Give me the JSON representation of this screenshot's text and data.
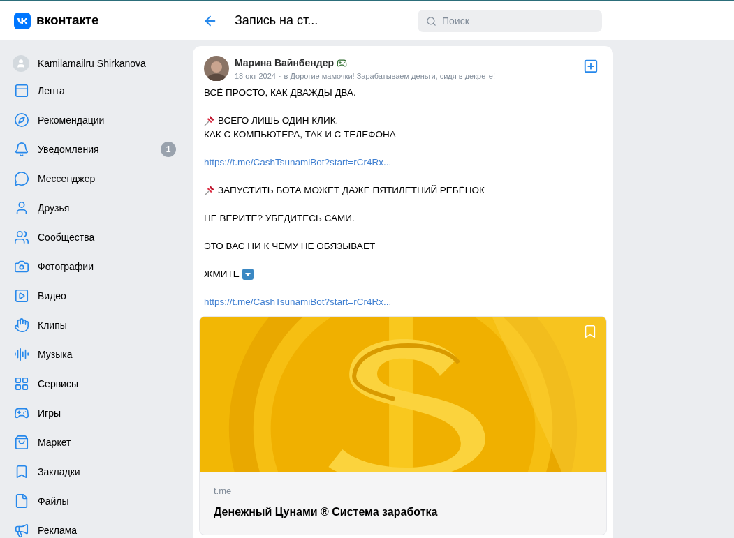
{
  "header": {
    "logo": "вконтакте",
    "title": "Запись на ст...",
    "search": {
      "placeholder": "Поиск"
    }
  },
  "sidebar": {
    "profile": "Kamilamailru Shirkanova",
    "items": [
      {
        "label": "Лента"
      },
      {
        "label": "Рекомендации"
      },
      {
        "label": "Уведомления",
        "badge": "1"
      },
      {
        "label": "Мессенджер"
      },
      {
        "label": "Друзья"
      },
      {
        "label": "Сообщества"
      },
      {
        "label": "Фотографии"
      },
      {
        "label": "Видео"
      },
      {
        "label": "Клипы"
      },
      {
        "label": "Музыка"
      },
      {
        "label": "Сервисы"
      },
      {
        "label": "Игры"
      },
      {
        "label": "Маркет"
      },
      {
        "label": "Закладки"
      },
      {
        "label": "Файлы"
      },
      {
        "label": "Реклама"
      }
    ]
  },
  "post": {
    "author": "Марина Вайнбендер",
    "date": "18 окт 2024",
    "separator": "·",
    "group": "в Дорогие мамочки! Зарабатываем деньги, сидя в декрете!",
    "paragraphs": [
      {
        "kind": "plain",
        "lines": [
          "ВСЁ ПРОСТО, КАК ДВАЖДЫ ДВА."
        ]
      },
      {
        "kind": "pinned",
        "lines": [
          "ВСЕГО ЛИШЬ ОДИН КЛИК.",
          "КАК С КОМПЬЮТЕРА, ТАК И С ТЕЛЕФОНА"
        ]
      },
      {
        "kind": "link",
        "lines": [
          "https://t.me/CashTsunamiBot?start=rCr4Rx..."
        ]
      },
      {
        "kind": "pinned",
        "lines": [
          "ЗАПУСТИТЬ БОТА МОЖЕТ ДАЖЕ ПЯТИЛЕТНИЙ РЕБЁНОК"
        ]
      },
      {
        "kind": "plain",
        "lines": [
          "НЕ ВЕРИТЕ? УБЕДИТЕСЬ САМИ."
        ]
      },
      {
        "kind": "plain",
        "lines": [
          "ЭТО ВАС НИ К ЧЕМУ НЕ ОБЯЗЫВАЕТ"
        ]
      },
      {
        "kind": "pointer",
        "lines": [
          "ЖМИТЕ"
        ]
      },
      {
        "kind": "link",
        "lines": [
          "https://t.me/CashTsunamiBot?start=rCr4Rx..."
        ]
      }
    ],
    "attachment": {
      "kind": "picture",
      "domain": "t.me",
      "title": "Денежный Цунами ® Система заработка"
    }
  }
}
